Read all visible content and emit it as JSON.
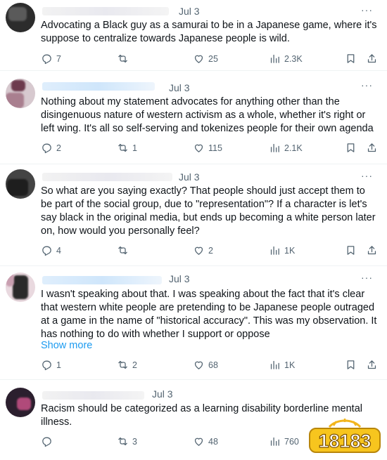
{
  "tweets": [
    {
      "date": "Jul 3",
      "text": "Advocating a Black guy as a samurai to be in a Japanese game, where it's suppose to  centralize towards Japanese people is wild.",
      "show_more": "",
      "replies": "7",
      "reposts": "",
      "likes": "25",
      "views": "2.3K"
    },
    {
      "date": "Jul 3",
      "text": "Nothing about my statement advocates for anything other than the disingenuous nature of western activism as a whole, whether it's right or left wing. It's all so self-serving and tokenizes people for their own agenda",
      "show_more": "",
      "replies": "2",
      "reposts": "1",
      "likes": "115",
      "views": "2.1K"
    },
    {
      "date": "Jul 3",
      "text": "So what are you saying exactly? That people should just accept them to be part of the social group, due to \"representation\"? If a character is let's say black in the original media, but ends up becoming a white person later on, how would you personally feel?",
      "show_more": "",
      "replies": "4",
      "reposts": "",
      "likes": "2",
      "views": "1K"
    },
    {
      "date": "Jul 3",
      "text": "I wasn't speaking about that. I was speaking about the fact that it's clear that western white people are pretending to be Japanese people outraged at a game in the name of \"historical accuracy\". This was my observation. It has nothing to do with whether I support or oppose",
      "show_more": "Show more",
      "replies": "1",
      "reposts": "2",
      "likes": "68",
      "views": "1K"
    },
    {
      "date": "Jul 3",
      "text": "Racism should be categorized as a learning disability borderline mental illness.",
      "show_more": "",
      "replies": "",
      "reposts": "3",
      "likes": "48",
      "views": "760"
    }
  ],
  "more_label": "···",
  "watermark": "18183",
  "icons": [
    "reply-icon",
    "repost-icon",
    "like-icon",
    "views-icon",
    "bookmark-icon",
    "share-icon"
  ],
  "colors": {
    "text": "#0f1419",
    "muted": "#536471",
    "link": "#1d9bf0"
  }
}
